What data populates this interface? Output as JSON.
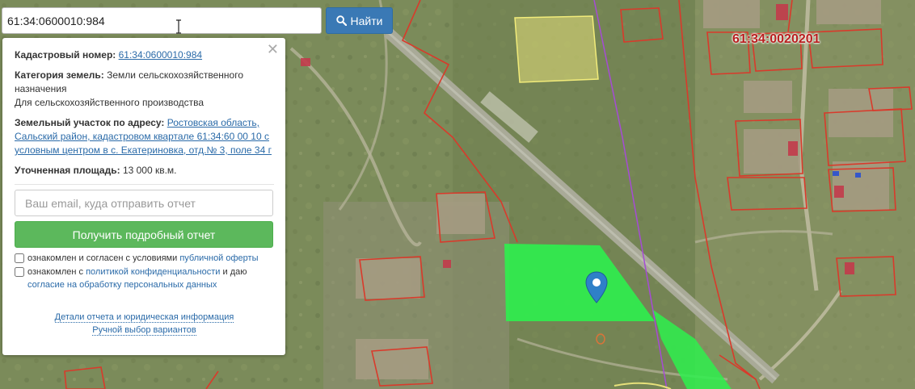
{
  "search": {
    "value": "61:34:0600010:984",
    "button_label": "Найти"
  },
  "info": {
    "cadastral_label": "Кадастровый номер:",
    "cadastral_value": "61:34:0600010:984",
    "category_label": "Категория земель:",
    "category_value": "Земли сельскохозяйственного назначения",
    "usage": "Для сельскохозяйственного производства",
    "address_label": "Земельный участок по адресу:",
    "address_value": "Ростовская область, Сальский район, кадастровом квартале 61:34:60 00 10 с условным центром в с. Екатериновка, отд.№ 3, поле 34 г",
    "area_label": "Уточненная площадь:",
    "area_value": "13 000 кв.м."
  },
  "report": {
    "email_placeholder": "Ваш email, куда отправить отчет",
    "button_label": "Получить подробный отчет",
    "consent1_text": "ознакомлен и согласен с условиями ",
    "consent1_link": "публичной оферты",
    "consent2_text": "ознакомлен с ",
    "consent2_link1": "политикой конфиденциальности",
    "consent2_mid": " и даю",
    "consent2_link2": "согласие на обработку персональных данных",
    "details_link": "Детали отчета и юридическая информация",
    "manual_link": "Ручной выбор вариантов"
  },
  "map": {
    "quarter_label": "61:34:0020201"
  },
  "icons": {
    "search": "search-icon",
    "close": "close-icon",
    "marker": "map-marker-icon",
    "cursor": "text-cursor-icon"
  },
  "colors": {
    "selected_parcel": "#2ef04e",
    "parcel_border": "#d93a2b",
    "marker": "#2f80c8",
    "primary_button": "#3a79b5",
    "report_button": "#5cb85c"
  }
}
